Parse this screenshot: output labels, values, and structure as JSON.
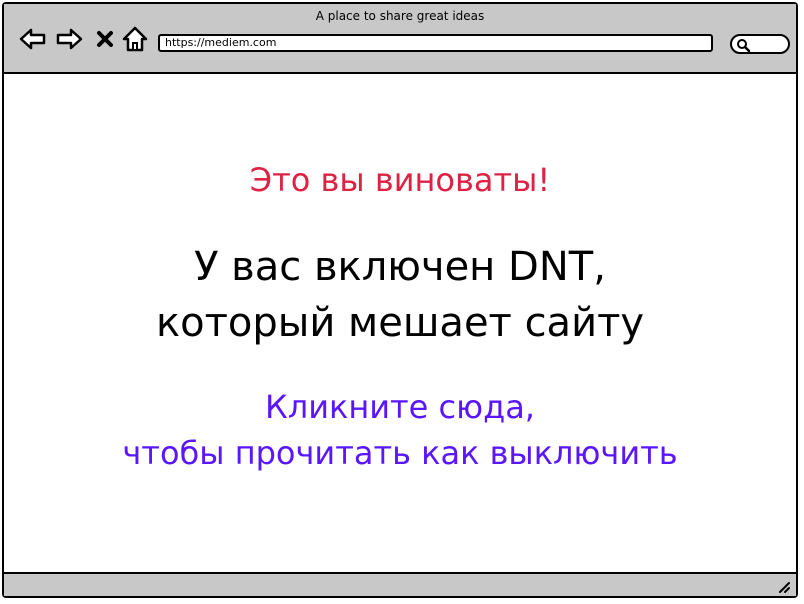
{
  "window": {
    "title": "A place to share great ideas"
  },
  "toolbar": {
    "url": "https://mediem.com",
    "icons": [
      "back-arrow-icon",
      "forward-arrow-icon",
      "close-icon",
      "home-icon",
      "search-icon"
    ]
  },
  "content": {
    "blame_text": "Это вы виноваты!",
    "dnt_line1": "У вас включен DNT,",
    "dnt_line2": "который мешает сайту",
    "link_line1": "Кликните сюда,",
    "link_line2": "чтобы прочитать как выключить"
  },
  "colors": {
    "chrome": "#c8c8c8",
    "blame": "#dd2244",
    "link": "#5a16ff",
    "text": "#000000"
  }
}
